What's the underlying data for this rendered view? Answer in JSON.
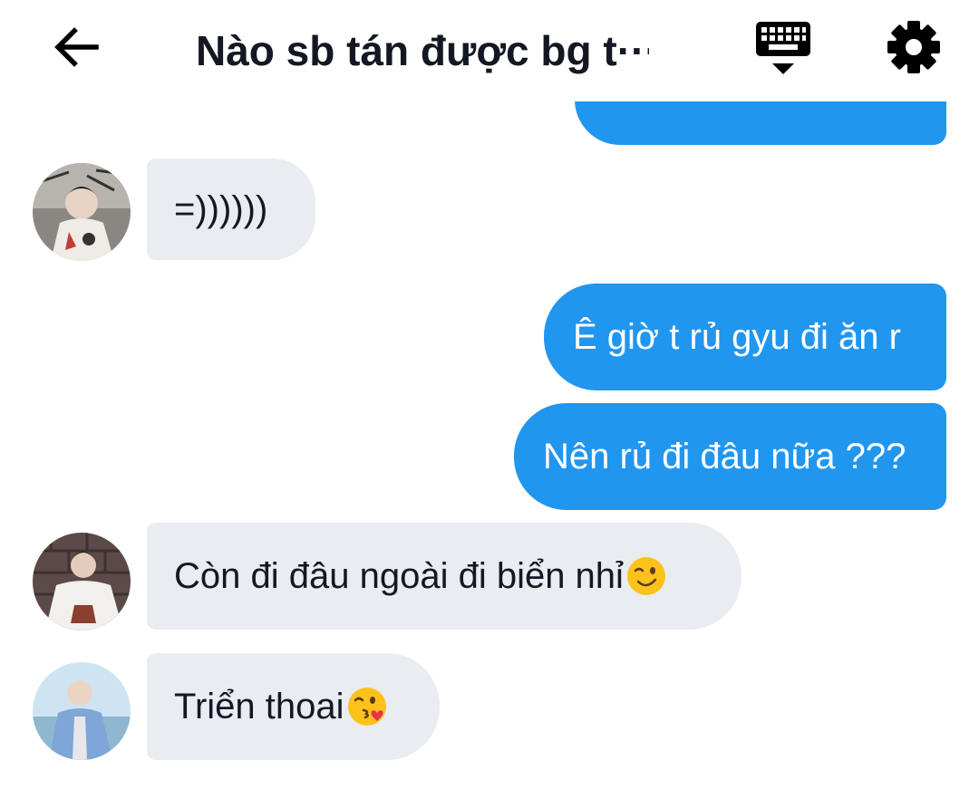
{
  "header": {
    "title": "Nào sb tán được bg t···",
    "icons": {
      "back": "back-arrow-icon",
      "keyboard": "keyboard-icon",
      "settings": "gear-icon"
    }
  },
  "colors": {
    "outgoing_bubble": "#2196ef",
    "incoming_bubble": "#e9ecf0",
    "text_dark": "#141823",
    "text_light": "#ffffff"
  },
  "messages": [
    {
      "direction": "outgoing",
      "text": ""
    },
    {
      "direction": "incoming",
      "text": "=))))))"
    },
    {
      "direction": "outgoing",
      "text": "Ê giờ t rủ gyu đi ăn r"
    },
    {
      "direction": "outgoing",
      "text": "Nên rủ đi đâu nữa ???"
    },
    {
      "direction": "incoming",
      "text": "Còn đi đâu ngoài đi biển nhỉ",
      "emoji": "winking-face-emoji"
    },
    {
      "direction": "incoming",
      "text": "Triển thoai",
      "emoji": "face-blowing-kiss-emoji"
    }
  ]
}
